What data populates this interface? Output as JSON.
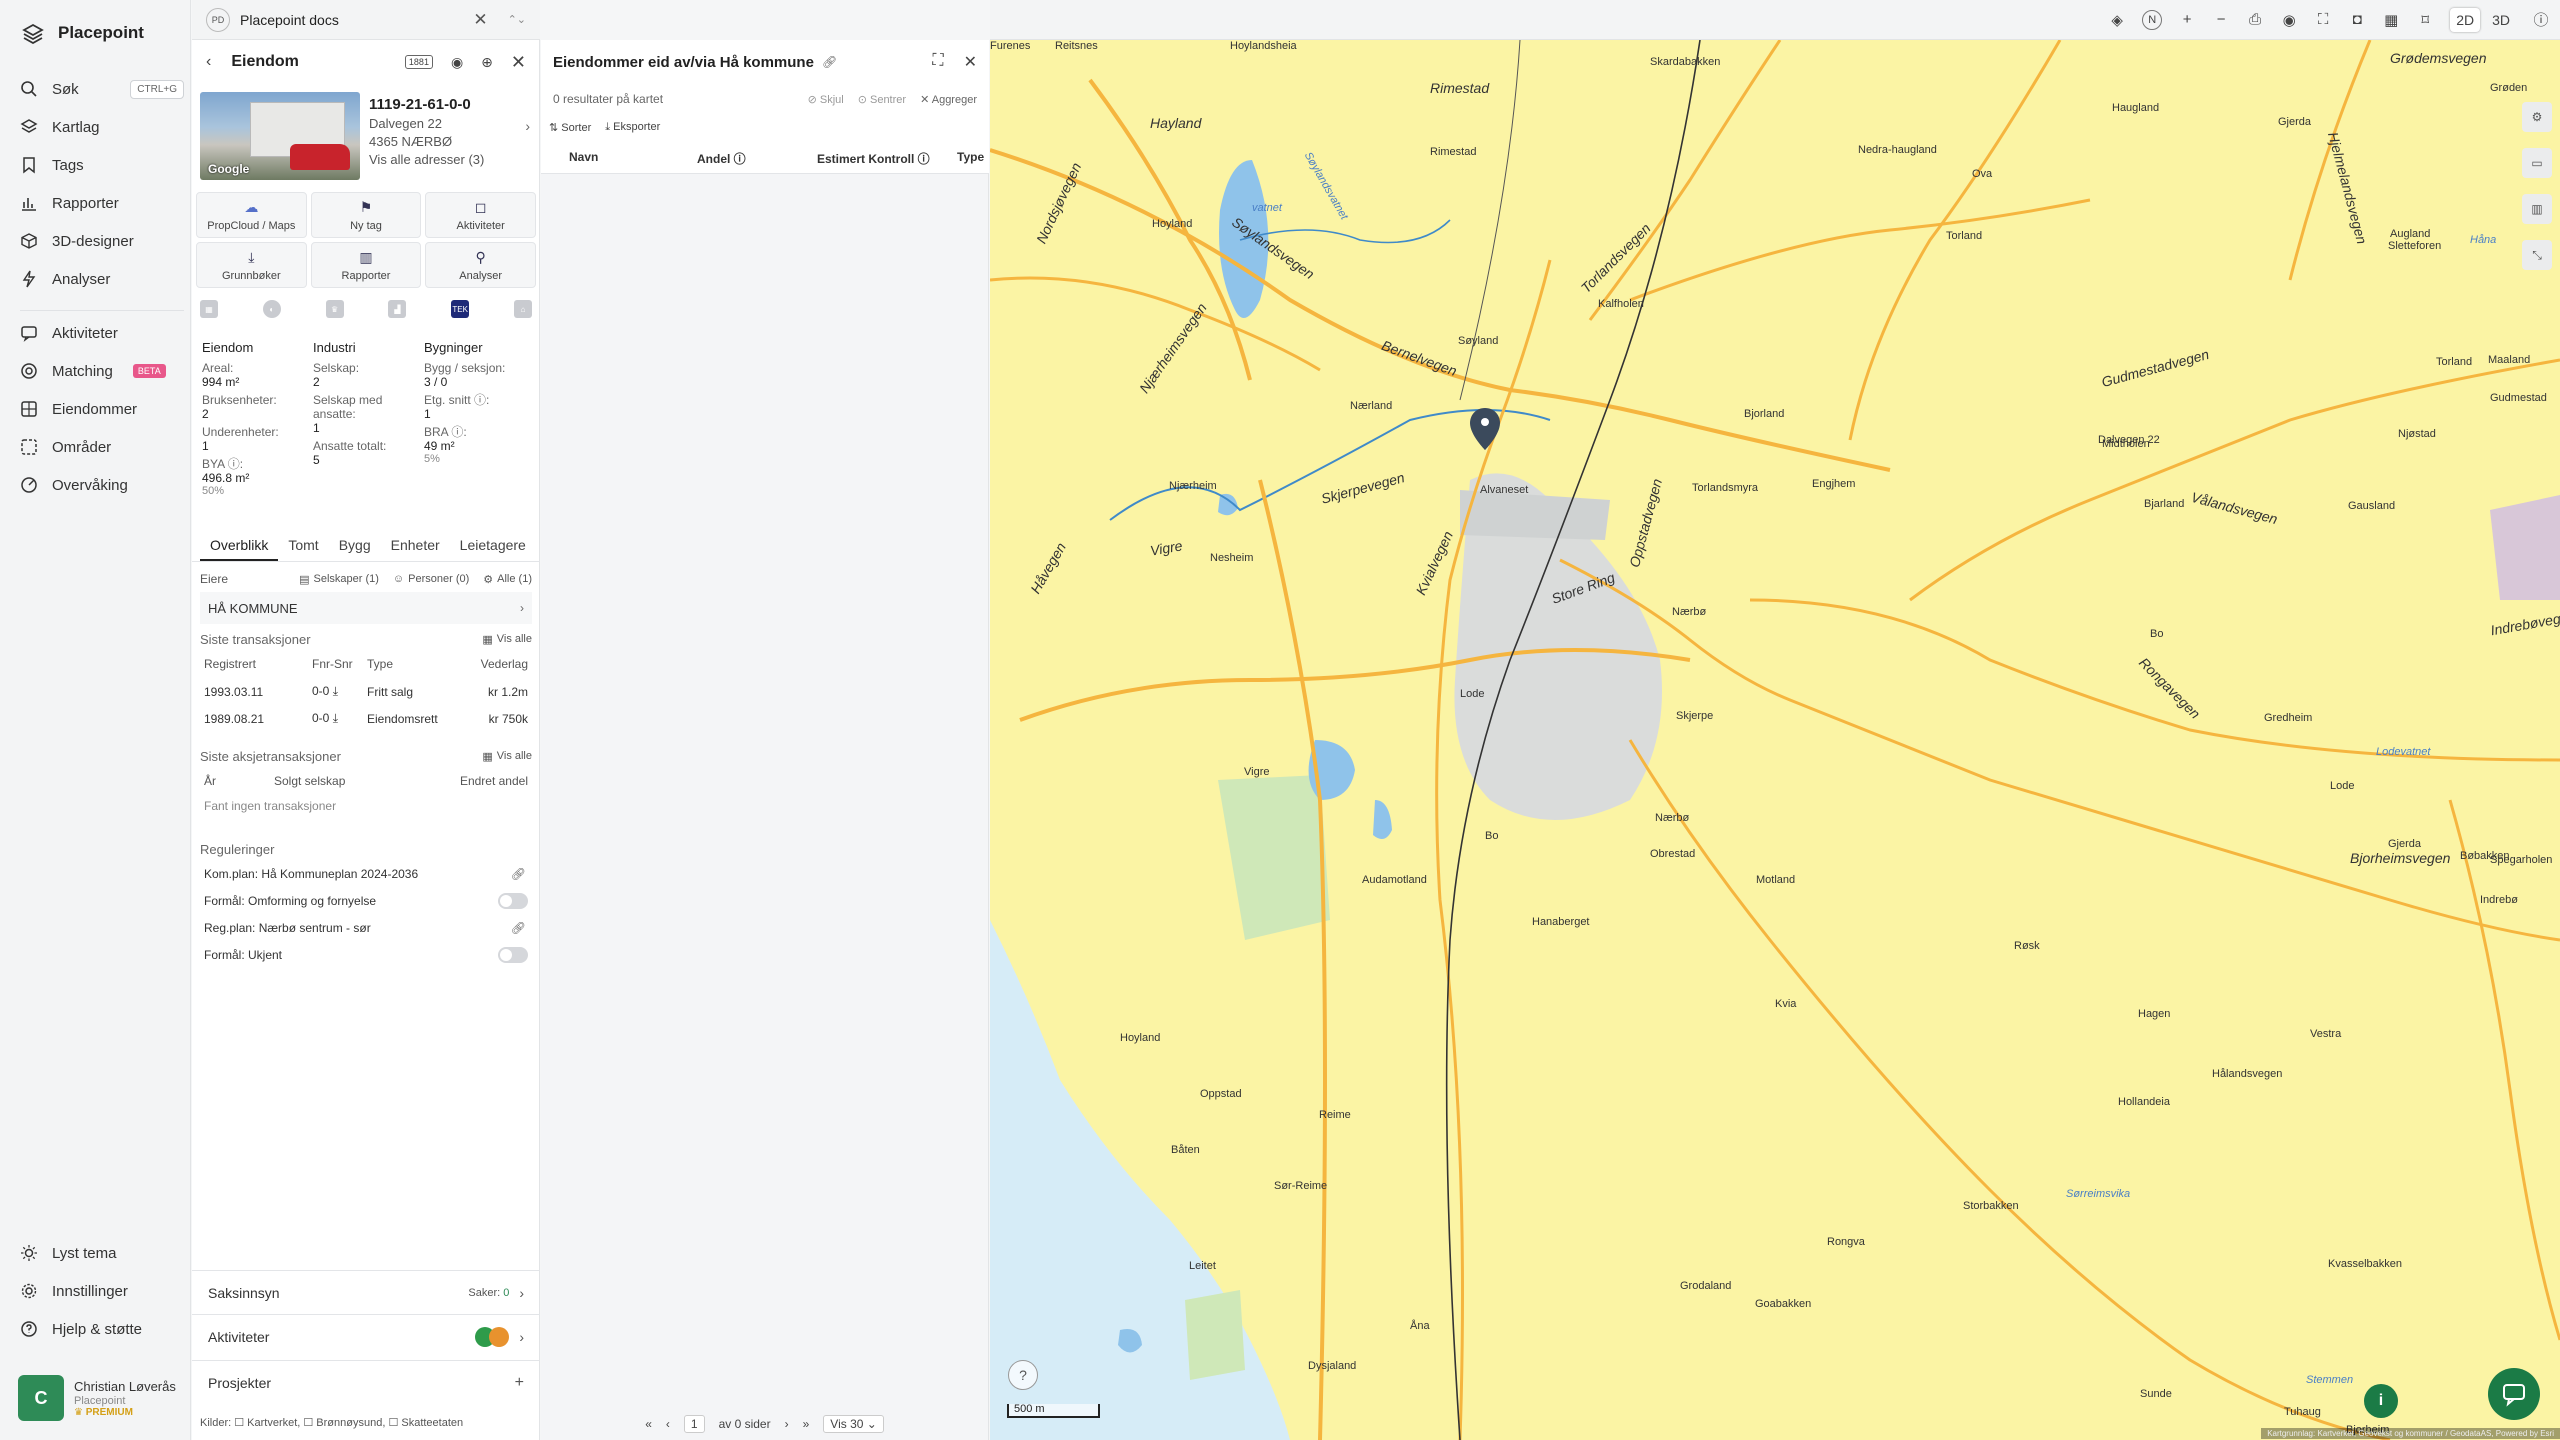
{
  "app": {
    "name": "Placepoint",
    "doc_tab": "Placepoint docs",
    "doc_badge": "PD"
  },
  "nav": {
    "items": [
      {
        "label": "Søk",
        "shortcut": "CTRL+G"
      },
      {
        "label": "Kartlag"
      },
      {
        "label": "Tags"
      },
      {
        "label": "Rapporter"
      },
      {
        "label": "3D-designer"
      },
      {
        "label": "Analyser"
      },
      {
        "label": "Aktiviteter"
      },
      {
        "label": "Matching",
        "badge": "BETA"
      },
      {
        "label": "Eiendommer"
      },
      {
        "label": "Områder"
      },
      {
        "label": "Overvåking"
      }
    ],
    "bottom": [
      {
        "label": "Lyst tema"
      },
      {
        "label": "Innstillinger"
      },
      {
        "label": "Hjelp & støtte"
      }
    ],
    "user": {
      "initial": "C",
      "name": "Christian Løverås",
      "org": "Placepoint",
      "tier": "PREMIUM"
    }
  },
  "property": {
    "header": "Eiendom",
    "header_badge": "1881",
    "gnr": "1119-21-61-0-0",
    "street": "Dalvegen 22",
    "postal": "4365 NÆRBØ",
    "all_addresses": "Vis alle adresser (3)",
    "photo_logo": "Google",
    "buttons": [
      {
        "label": "PropCloud / Maps",
        "icon": "☁"
      },
      {
        "label": "Ny tag",
        "icon": "⚑"
      },
      {
        "label": "Aktiviteter",
        "icon": "◻"
      },
      {
        "label": "Grunnbøker",
        "icon": "⤓"
      },
      {
        "label": "Rapporter",
        "icon": "▥"
      },
      {
        "label": "Analyser",
        "icon": "⚲"
      }
    ],
    "tek_label": "TEK",
    "stats": {
      "eiendom": {
        "title": "Eiendom",
        "areal_k": "Areal:",
        "areal_v": "994 m²",
        "bruks_k": "Bruksenheter:",
        "bruks_v": "2",
        "under_k": "Underenheter:",
        "under_v": "1",
        "bya_k": "BYA ⓘ:",
        "bya_v": "496.8 m²",
        "bya_pct": "50%"
      },
      "industri": {
        "title": "Industri",
        "selskap_k": "Selskap:",
        "selskap_v": "2",
        "ansatte_k": "Selskap med ansatte:",
        "ansatte_v": "1",
        "total_k": "Ansatte totalt:",
        "total_v": "5"
      },
      "bygninger": {
        "title": "Bygninger",
        "bygg_k": "Bygg / seksjon:",
        "bygg_v": "3 / 0",
        "etg_k": "Etg. snitt ⓘ:",
        "etg_v": "1",
        "bra_k": "BRA ⓘ:",
        "bra_v": "49 m²",
        "bra_pct": "5%"
      }
    },
    "tabs": [
      "Overblikk",
      "Tomt",
      "Bygg",
      "Enheter",
      "Leietagere"
    ],
    "owners": {
      "title": "Eiere",
      "selskaper": "Selskaper (1)",
      "personer": "Personer (0)",
      "alle": "Alle (1)",
      "name": "HÅ KOMMUNE"
    },
    "transactions": {
      "title": "Siste transaksjoner",
      "vis_alle": "Vis alle",
      "cols": [
        "Registrert",
        "Fnr-Snr",
        "Type",
        "Vederlag"
      ],
      "rows": [
        {
          "date": "1993.03.11",
          "fnr": "0-0",
          "type": "Fritt salg",
          "amount": "kr 1.2m"
        },
        {
          "date": "1989.08.21",
          "fnr": "0-0",
          "type": "Eiendomsrett",
          "amount": "kr 750k"
        }
      ]
    },
    "stock_tx": {
      "title": "Siste aksjetransaksjoner",
      "vis_alle": "Vis alle",
      "cols": [
        "År",
        "Solgt selskap",
        "Endret andel"
      ],
      "empty": "Fant ingen transaksjoner"
    },
    "regulations": {
      "title": "Reguleringer",
      "items": [
        {
          "label": "Kom.plan: Hå Kommuneplan 2024-2036",
          "kind": "link"
        },
        {
          "label": "Formål: Omforming og fornyelse",
          "kind": "toggle"
        },
        {
          "label": "Reg.plan: Nærbø sentrum - sør",
          "kind": "link"
        },
        {
          "label": "Formål: Ukjent",
          "kind": "toggle"
        }
      ]
    },
    "bottom": {
      "saksinnsyn": "Saksinnsyn",
      "saker_label": "Saker:",
      "saker_count": "0",
      "aktiviteter": "Aktiviteter",
      "prosjekter": "Prosjekter"
    },
    "sources": "Kilder: ☐ Kartverket, ☐ Brønnøysund, ☐ Skatteetaten"
  },
  "list": {
    "title": "Eiendommer eid av/via Hå kommune",
    "results": "0 resultater på kartet",
    "actions": [
      "Skjul",
      "Sentrer",
      "Aggreger"
    ],
    "tools": [
      "Sorter",
      "Eksporter"
    ],
    "cols": [
      "Navn",
      "Andel ⓘ",
      "Estimert Kontroll ⓘ",
      "Type"
    ],
    "pager": {
      "page": "1",
      "of": "av 0 sider",
      "per_page": "Vis 30"
    }
  },
  "map": {
    "topbar": {
      "mode_2d": "2D",
      "mode_3d": "3D",
      "compass": "N"
    },
    "scale": "500 m",
    "attribution": "Kartgrunnlag: Kartverket, Geovekst og kommuner / GeodataAS, Powered by Esri",
    "marker_label": "Dalvegen 22",
    "roads": [
      "Nordsjøvegen",
      "Søylandsvegen",
      "Njærheimsvegen",
      "Bernelvegen",
      "Torlandsvegen",
      "Gudmestadvegen",
      "Skjerpevegen",
      "Vigre",
      "Håvegen",
      "Kvialvegen",
      "Store Ring",
      "Vålandsvegen",
      "Rongavegen",
      "Indrebøvegen",
      "Hjelmelandsvegen",
      "Oppstadvegen",
      "Rimestad",
      "Hayland",
      "Bjorheimsvegen",
      "Grødemsvegen"
    ],
    "places": [
      "Reitsnes",
      "Hoylandsheia",
      "Skardabakken",
      "Grøden",
      "Gjerda",
      "Nedra-haugland",
      "Ova",
      "Haugland",
      "Rimestad",
      "Hoyland",
      "Torland",
      "Augland",
      "Sletteforen",
      "Kalfholen",
      "Søyland",
      "Maaland",
      "Torland",
      "Nærland",
      "Bjorland",
      "Midtholen",
      "Njøstad",
      "Gudmestad",
      "Njærheim",
      "Torlandsmyra",
      "Bjarland",
      "Alvaneset",
      "Nesheim",
      "Engjhem",
      "Gausland",
      "Bo",
      "Nærbø",
      "Lode",
      "Skjerpe",
      "Gredheim",
      "Vigre",
      "Lode",
      "Nærbø",
      "Bo",
      "Obrestad",
      "Gjerda",
      "Bøbakken",
      "Spegarholen",
      "Audamotland",
      "Hanaberget",
      "Motland",
      "Røsk",
      "Indrebø",
      "Hoyland",
      "Kvia",
      "Hagen",
      "Vestra",
      "Hålandsvegen",
      "Hollandeia",
      "Oppstad",
      "Reime",
      "Båten",
      "Sør-Reime",
      "Storbakken",
      "Rongva",
      "Leitet",
      "Grodaland",
      "Goabakken",
      "Kvasselbakken",
      "Åna",
      "Dysjaland",
      "Sunde",
      "Tuhaug",
      "Bjorheim",
      "Furenes"
    ],
    "waters": [
      "Søylandsvatnet",
      "vatnet",
      "Håna",
      "Lodevatnet",
      "Sørreimsvika",
      "Stemmen"
    ],
    "colors": {
      "land": "#fbf4a4",
      "sea": "#d6ecf7",
      "road": "#f5b53f",
      "water": "#3f8ac9",
      "forest": "#cfe8b8",
      "urban": "#dadcdb"
    }
  }
}
